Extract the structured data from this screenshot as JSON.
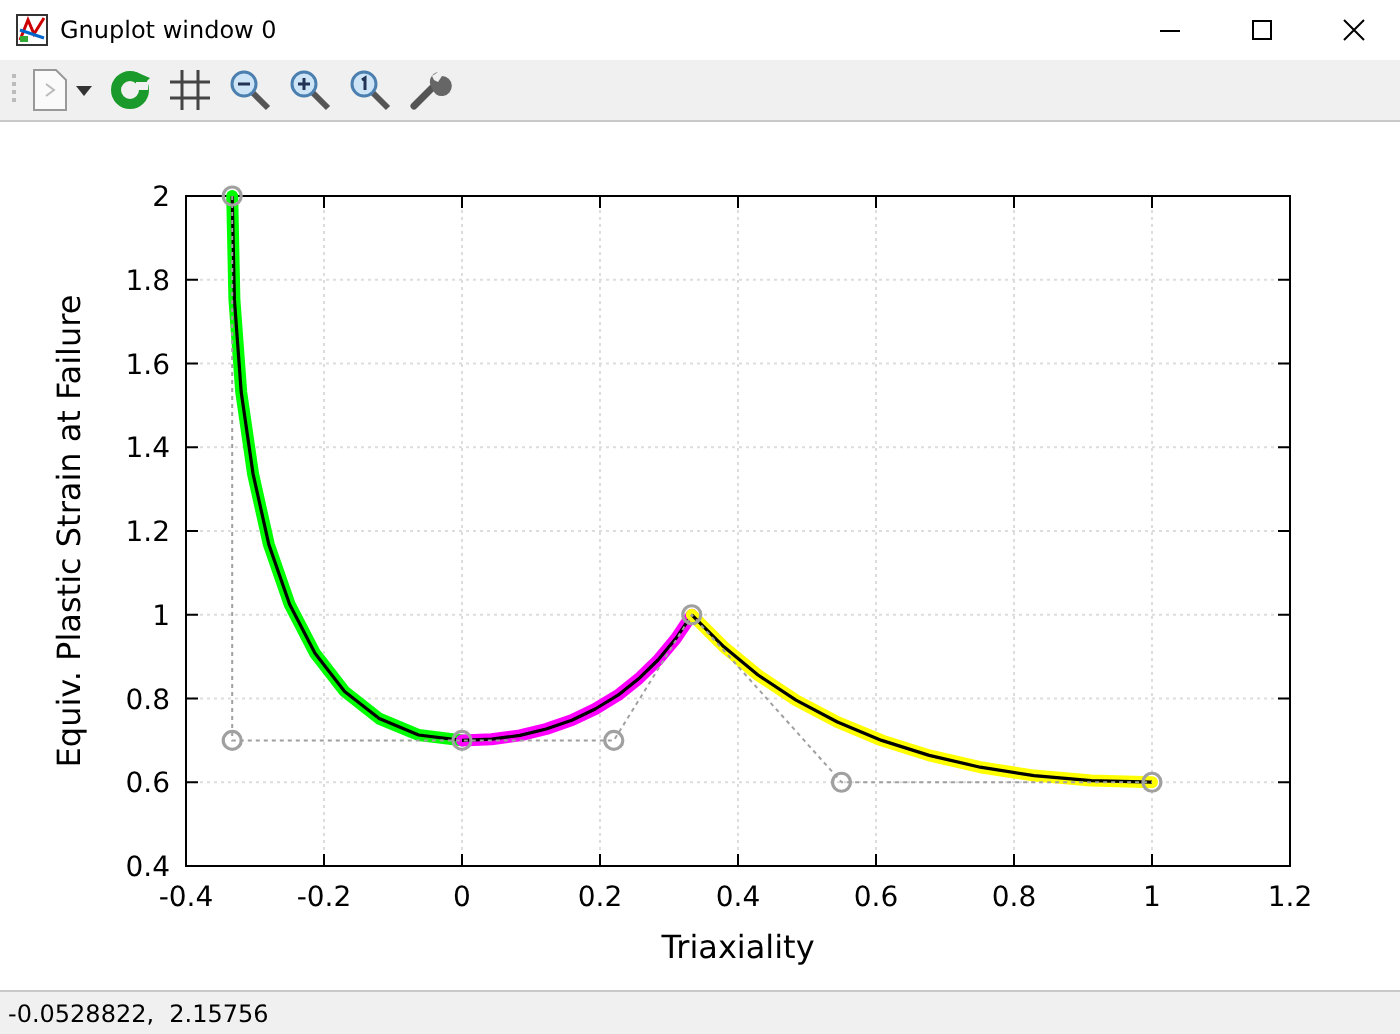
{
  "window": {
    "title": "Gnuplot window 0"
  },
  "plot": {
    "chart_data": {
      "type": "line",
      "xlabel": "Triaxiality",
      "ylabel": "Equiv. Plastic Strain at Failure",
      "xlim": [
        -0.4,
        1.2
      ],
      "ylim": [
        0.4,
        2
      ],
      "xticks": [
        -0.4,
        -0.2,
        0,
        0.2,
        0.4,
        0.6,
        0.8,
        1,
        1.2
      ],
      "yticks": [
        0.4,
        0.6,
        0.8,
        1,
        1.2,
        1.4,
        1.6,
        1.8,
        2
      ],
      "grid": true,
      "x": [
        -0.333,
        -0.333,
        -0.33,
        -0.32,
        -0.303,
        -0.28,
        -0.25,
        -0.213,
        -0.17,
        -0.12,
        -0.063,
        0,
        0.043,
        0.084,
        0.122,
        0.159,
        0.193,
        0.22,
        0.226,
        0.256,
        0.284,
        0.31,
        0.333,
        0.379,
        0.429,
        0.484,
        0.544,
        0.55,
        0.608,
        0.677,
        0.751,
        0.829,
        0.912,
        1
      ],
      "series": [
        {
          "color": "#a0a0a0",
          "line_style": "dashed",
          "marker": "circle",
          "values": [
            2,
            0.7,
            null,
            null,
            null,
            null,
            null,
            null,
            null,
            null,
            null,
            0.7,
            null,
            null,
            null,
            null,
            null,
            0.7,
            null,
            null,
            null,
            null,
            1,
            null,
            null,
            null,
            null,
            0.6,
            null,
            null,
            null,
            null,
            null,
            0.6
          ]
        },
        {
          "color": "#00ff00",
          "values": [
            2,
            null,
            1.753,
            1.532,
            1.337,
            1.168,
            1.025,
            0.908,
            0.817,
            0.752,
            0.713,
            0.7,
            null,
            null,
            null,
            null,
            null,
            null,
            null,
            null,
            null,
            null,
            null,
            null,
            null,
            null,
            null,
            null,
            null,
            null,
            null,
            null,
            null,
            null
          ]
        },
        {
          "color": "#ff00ff",
          "values": [
            null,
            null,
            null,
            null,
            null,
            null,
            null,
            null,
            null,
            null,
            null,
            0.7,
            0.703,
            0.712,
            0.727,
            0.748,
            0.775,
            null,
            0.808,
            0.847,
            0.892,
            0.943,
            1,
            null,
            null,
            null,
            null,
            null,
            null,
            null,
            null,
            null,
            null,
            null
          ]
        },
        {
          "color": "#ffff00",
          "values": [
            null,
            null,
            null,
            null,
            null,
            null,
            null,
            null,
            null,
            null,
            null,
            null,
            null,
            null,
            null,
            null,
            null,
            null,
            null,
            null,
            null,
            null,
            1,
            0.924,
            0.856,
            0.796,
            0.744,
            null,
            0.7,
            0.664,
            0.636,
            0.616,
            0.604,
            0.6
          ]
        }
      ]
    }
  },
  "status_bar": {
    "text": "-0.0528822,  2.15756"
  }
}
